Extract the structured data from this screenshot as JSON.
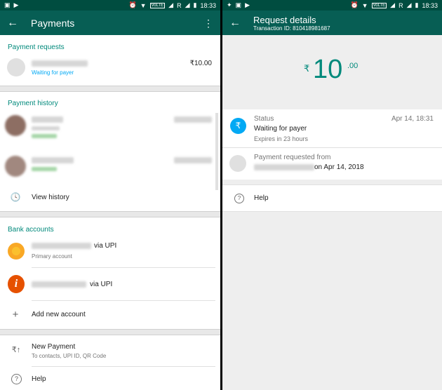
{
  "status_bar": {
    "time": "18:33",
    "network": "R",
    "volte": "VoLTE"
  },
  "left": {
    "title": "Payments",
    "payment_requests": {
      "header": "Payment requests",
      "item": {
        "status": "Waiting for payer",
        "amount": "₹10.00"
      }
    },
    "payment_history": {
      "header": "Payment history",
      "view_history": "View history"
    },
    "bank_accounts": {
      "header": "Bank accounts",
      "accounts": [
        {
          "suffix": "via UPI",
          "sub": "Primary account"
        },
        {
          "suffix": "via UPI"
        }
      ],
      "add": "Add new account"
    },
    "new_payment": {
      "title": "New Payment",
      "sub": "To contacts, UPI ID, QR Code"
    },
    "help": "Help"
  },
  "right": {
    "title": "Request details",
    "transaction": "Transaction ID: 810418981687",
    "amount": {
      "currency": "₹",
      "whole": "10",
      "decimal": ".00"
    },
    "status": {
      "label": "Status",
      "date": "Apr 14, 18:31",
      "value": "Waiting for payer",
      "expires": "Expires in 23 hours"
    },
    "requested": {
      "label": "Payment requested from",
      "date_text": "on Apr 14, 2018"
    },
    "help": "Help"
  },
  "colors": {
    "appbar": "#075e54",
    "statusbar": "#004d40",
    "accent": "#00897b",
    "link": "#03a9f4"
  }
}
